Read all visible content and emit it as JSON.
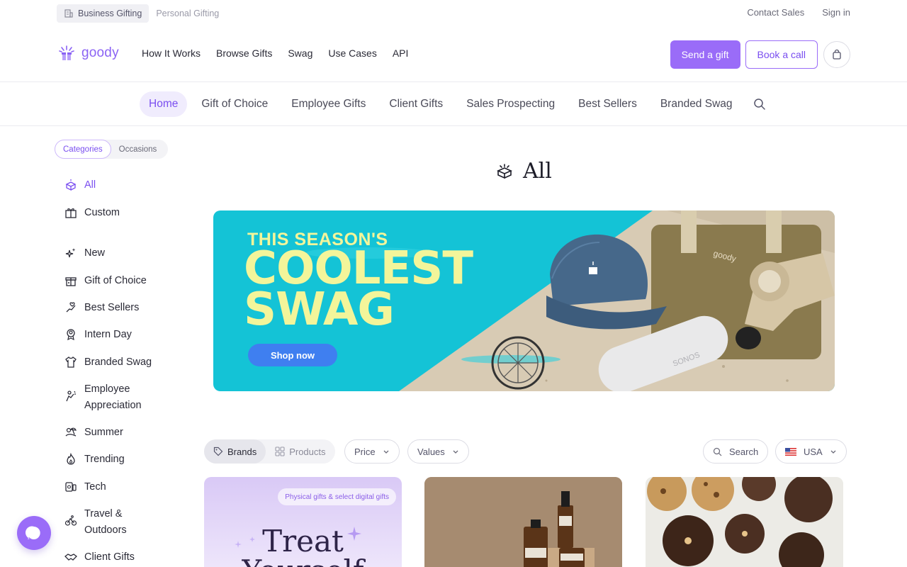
{
  "util": {
    "tabs": [
      {
        "label": "Business Gifting",
        "active": true
      },
      {
        "label": "Personal Gifting",
        "active": false
      }
    ],
    "contact": "Contact Sales",
    "signin": "Sign in"
  },
  "nav": {
    "logo": "goody",
    "links": [
      "How It Works",
      "Browse Gifts",
      "Swag",
      "Use Cases",
      "API"
    ],
    "send_gift": "Send a gift",
    "book_call": "Book a call"
  },
  "catnav": {
    "items": [
      "Home",
      "Gift of Choice",
      "Employee Gifts",
      "Client Gifts",
      "Sales Prospecting",
      "Best Sellers",
      "Branded Swag"
    ],
    "active": "Home"
  },
  "sidebar": {
    "toggle": [
      "Categories",
      "Occasions"
    ],
    "items": [
      {
        "label": "All",
        "icon": "gift-box-icon"
      },
      {
        "label": "Custom",
        "icon": "custom-gift-icon"
      },
      {
        "label": "New",
        "icon": "sparkles-icon"
      },
      {
        "label": "Gift of Choice",
        "icon": "gift-choice-icon"
      },
      {
        "label": "Best Sellers",
        "icon": "hand-heart-icon"
      },
      {
        "label": "Intern Day",
        "icon": "intern-badge-icon"
      },
      {
        "label": "Branded Swag",
        "icon": "tshirt-icon"
      },
      {
        "label": "Employee Appreciation",
        "icon": "person-celebrate-icon"
      },
      {
        "label": "Summer",
        "icon": "sun-beach-icon"
      },
      {
        "label": "Trending",
        "icon": "flame-icon"
      },
      {
        "label": "Tech",
        "icon": "devices-icon"
      },
      {
        "label": "Travel & Outdoors",
        "icon": "bike-icon"
      },
      {
        "label": "Client Gifts",
        "icon": "handshake-icon"
      }
    ]
  },
  "heading": "All",
  "banner": {
    "line1": "THIS SEASON'S",
    "line2": "COOLEST",
    "line3": "SWAG",
    "cta": "Shop now"
  },
  "filters": {
    "segments": [
      "Brands",
      "Products"
    ],
    "price": "Price",
    "values": "Values",
    "search": "Search",
    "country": "USA"
  },
  "cards": {
    "card1_pill": "Physical gifts & select digital gifts",
    "card1_title": "Treat Yourself"
  },
  "colors": {
    "accent": "#9a6cf8",
    "banner_bg": "#14c3d6",
    "banner_text": "#f3f59a",
    "cta_blue": "#3f7ff0"
  }
}
